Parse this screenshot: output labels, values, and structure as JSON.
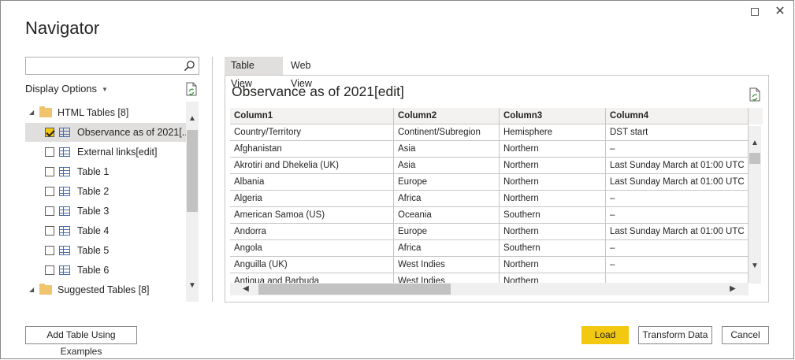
{
  "window": {
    "title": "Navigator"
  },
  "search": {
    "placeholder": "",
    "value": ""
  },
  "display_options": {
    "label": "Display Options"
  },
  "tree": {
    "groups": [
      {
        "label": "HTML Tables [8]"
      },
      {
        "label": "Suggested Tables [8]"
      }
    ],
    "items": [
      {
        "label": "Observance as of 2021[...",
        "checked": true,
        "selected": true
      },
      {
        "label": "External links[edit]",
        "checked": false
      },
      {
        "label": "Table 1",
        "checked": false
      },
      {
        "label": "Table 2",
        "checked": false
      },
      {
        "label": "Table 3",
        "checked": false
      },
      {
        "label": "Table 4",
        "checked": false
      },
      {
        "label": "Table 5",
        "checked": false
      },
      {
        "label": "Table 6",
        "checked": false
      }
    ]
  },
  "tabs": [
    {
      "label": "Table View",
      "active": true
    },
    {
      "label": "Web View",
      "active": false
    }
  ],
  "preview": {
    "title": "Observance as of 2021[edit]",
    "columns": [
      "Column1",
      "Column2",
      "Column3",
      "Column4"
    ],
    "rows": [
      [
        "Country/Territory",
        "Continent/Subregion",
        "Hemisphere",
        "DST start"
      ],
      [
        "Afghanistan",
        "Asia",
        "Northern",
        "–"
      ],
      [
        "Akrotiri and Dhekelia (UK)",
        "Asia",
        "Northern",
        "Last Sunday March at 01:00 UTC"
      ],
      [
        "Albania",
        "Europe",
        "Northern",
        "Last Sunday March at 01:00 UTC"
      ],
      [
        "Algeria",
        "Africa",
        "Northern",
        "–"
      ],
      [
        "American Samoa (US)",
        "Oceania",
        "Southern",
        "–"
      ],
      [
        "Andorra",
        "Europe",
        "Northern",
        "Last Sunday March at 01:00 UTC"
      ],
      [
        "Angola",
        "Africa",
        "Southern",
        "–"
      ],
      [
        "Anguilla (UK)",
        "West Indies",
        "Northern",
        "–"
      ],
      [
        "Antigua and Barbuda",
        "West Indies",
        "Northern",
        ""
      ]
    ]
  },
  "buttons": {
    "add_table": "Add Table Using Examples",
    "load": "Load",
    "transform": "Transform Data",
    "cancel": "Cancel"
  },
  "colors": {
    "accent": "#f2c811",
    "selection": "#e1dfdd"
  }
}
